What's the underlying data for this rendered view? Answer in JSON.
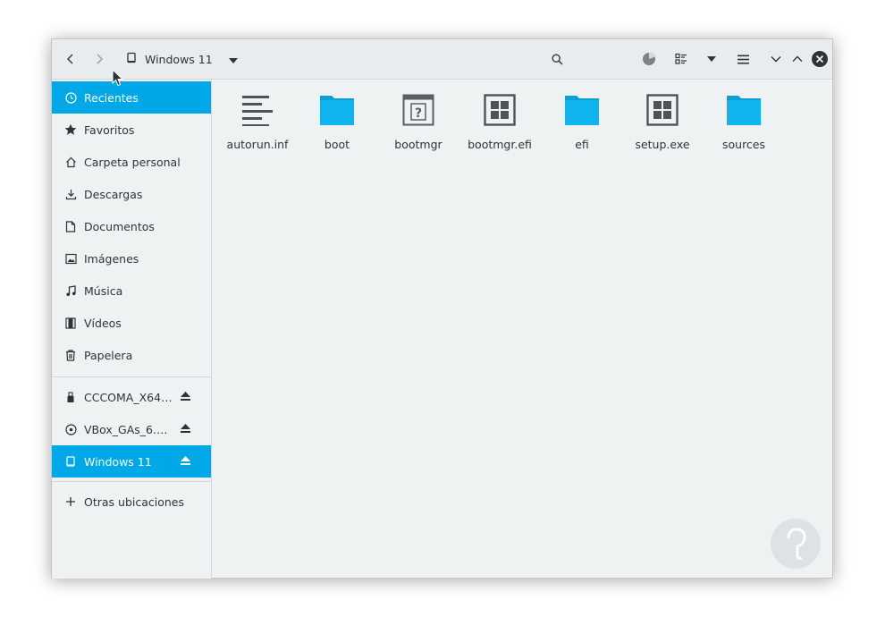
{
  "header": {
    "path_label": "Windows 11",
    "icons": {
      "back": "back-arrow-icon",
      "forward": "forward-arrow-icon",
      "drive": "drive-icon",
      "path_menu": "dropdown-icon",
      "search": "search-icon",
      "disk_usage": "pie-icon",
      "view": "view-icon",
      "view_menu": "dropdown-icon",
      "menu": "hamburger-icon",
      "minimize": "minimize-icon",
      "maximize": "maximize-icon",
      "close": "close-icon"
    }
  },
  "sidebar": {
    "items": [
      {
        "label": "Recientes",
        "icon": "clock-icon",
        "active": true
      },
      {
        "label": "Favoritos",
        "icon": "star-icon"
      },
      {
        "label": "Carpeta personal",
        "icon": "home-icon"
      },
      {
        "label": "Descargas",
        "icon": "download-icon"
      },
      {
        "label": "Documentos",
        "icon": "document-icon"
      },
      {
        "label": "Imágenes",
        "icon": "image-icon"
      },
      {
        "label": "Música",
        "icon": "music-icon"
      },
      {
        "label": "Vídeos",
        "icon": "video-icon"
      },
      {
        "label": "Papelera",
        "icon": "trash-icon"
      }
    ],
    "devices": [
      {
        "label": "CCCOMA_X64…",
        "icon": "usb-icon"
      },
      {
        "label": "VBox_GAs_6.…",
        "icon": "disc-icon"
      },
      {
        "label": "Windows 11",
        "icon": "drive-icon",
        "active": true
      }
    ],
    "other": {
      "label": "Otras ubicaciones",
      "icon": "plus-icon"
    }
  },
  "files": [
    {
      "name": "autorun.inf",
      "icon": "text-file-icon"
    },
    {
      "name": "boot",
      "icon": "folder-icon"
    },
    {
      "name": "bootmgr",
      "icon": "unknown-file-icon"
    },
    {
      "name": "bootmgr.efi",
      "icon": "executable-icon"
    },
    {
      "name": "efi",
      "icon": "folder-icon"
    },
    {
      "name": "setup.exe",
      "icon": "executable-icon"
    },
    {
      "name": "sources",
      "icon": "folder-icon"
    }
  ],
  "colors": {
    "accent": "#00a8e8",
    "folder": "#0fb4ee",
    "folder_tab": "#0a9fd6"
  }
}
